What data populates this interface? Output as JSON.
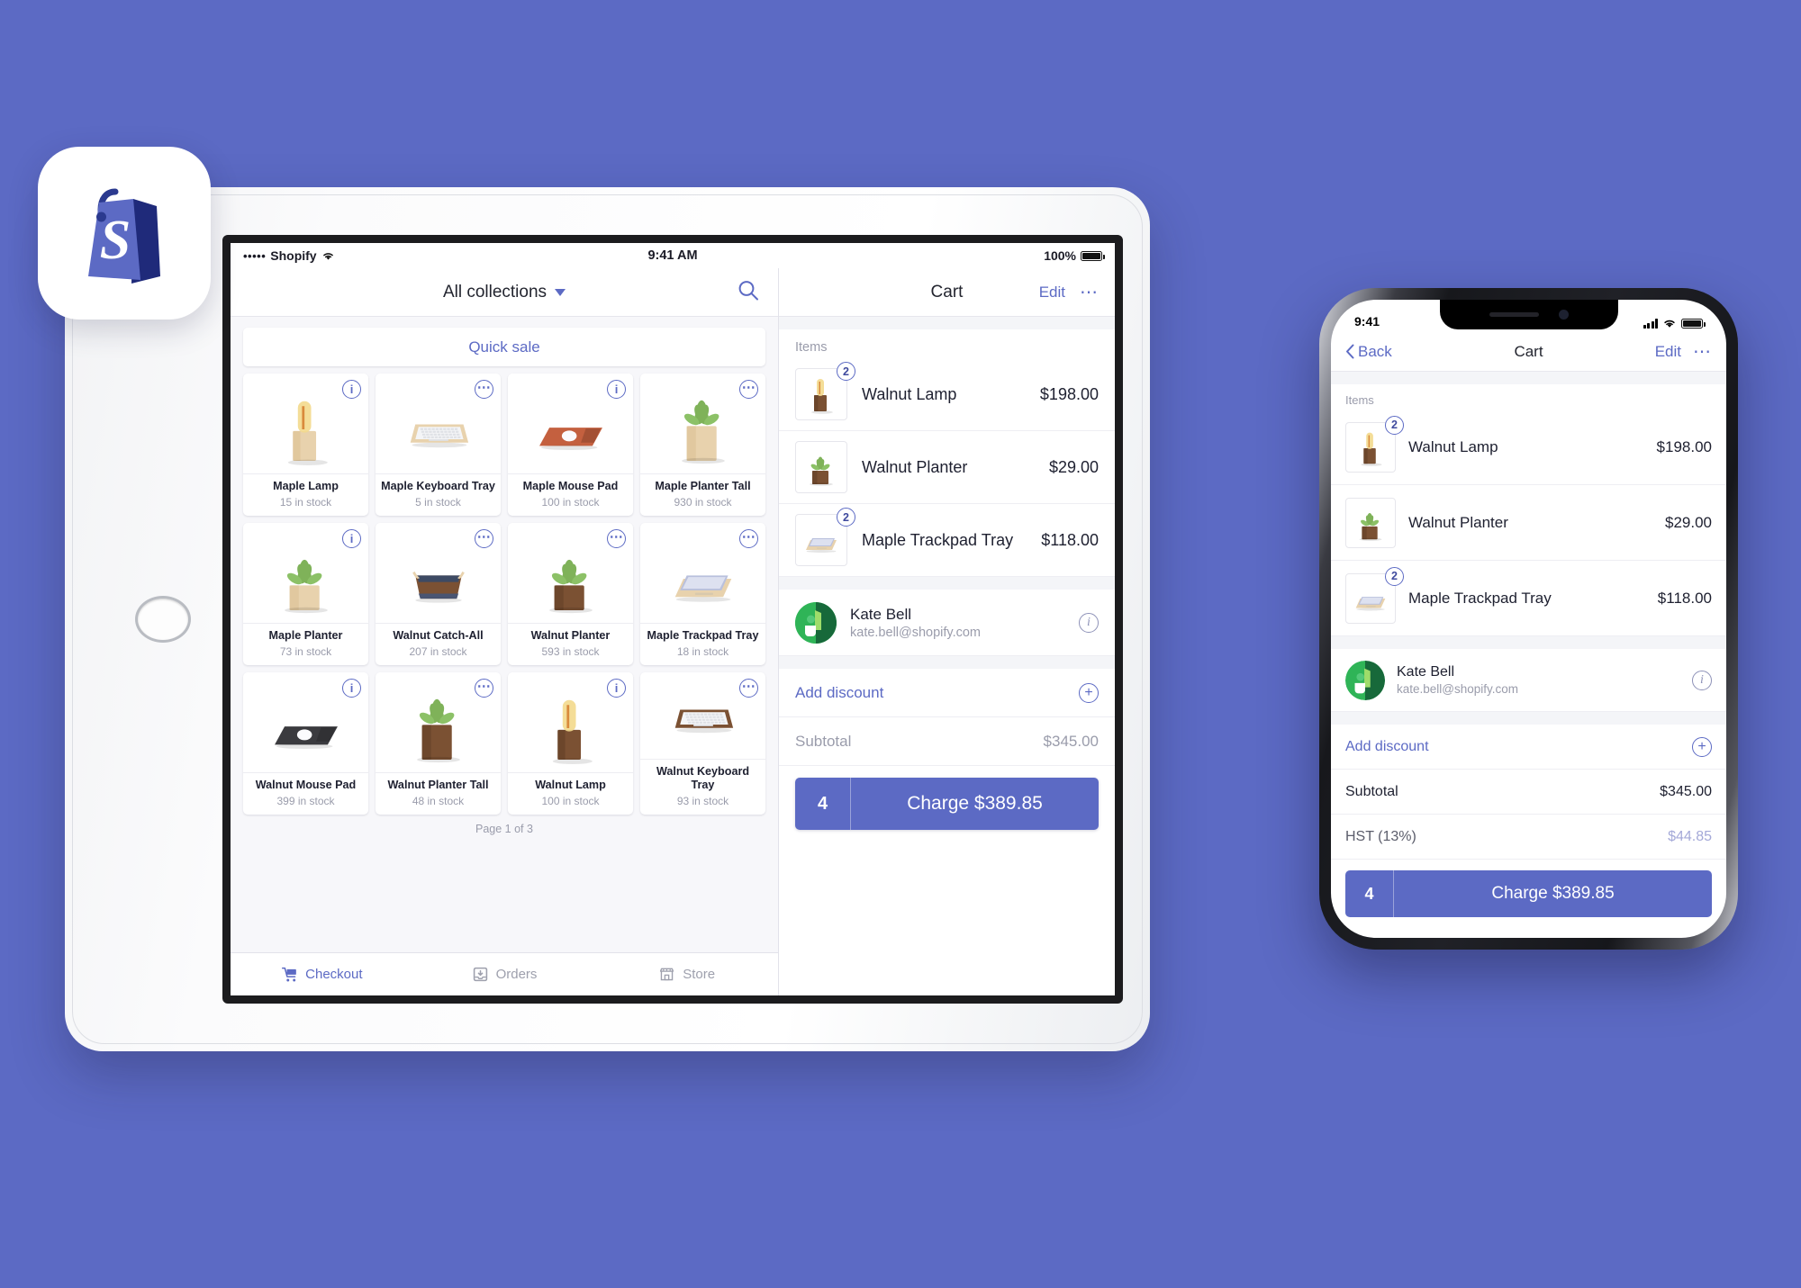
{
  "brand": {
    "accent": "#5c6ac4",
    "background": "#5c6ac4",
    "app_icon": "shopify-bag-icon"
  },
  "ipad": {
    "status_bar": {
      "carrier": "Shopify",
      "signal_dots": "•••••",
      "wifi_icon": "wifi-icon",
      "time": "9:41 AM",
      "battery_percent": "100%",
      "battery_icon": "battery-full-icon"
    },
    "catalog": {
      "collections_label": "All collections",
      "dropdown_icon": "chevron-down-icon",
      "search_icon": "search-icon",
      "quick_sale_label": "Quick sale",
      "page_indicator": "Page 1 of 3",
      "products": [
        {
          "name": "Maple Lamp",
          "stock": "15 in stock",
          "badge": "info",
          "image": "maple-lamp"
        },
        {
          "name": "Maple Keyboard Tray",
          "stock": "5 in stock",
          "badge": "more",
          "image": "maple-keyboard-tray"
        },
        {
          "name": "Maple Mouse Pad",
          "stock": "100 in stock",
          "badge": "info",
          "image": "maple-mouse-pad"
        },
        {
          "name": "Maple Planter Tall",
          "stock": "930 in stock",
          "badge": "more",
          "image": "maple-planter-tall"
        },
        {
          "name": "Maple Planter",
          "stock": "73 in stock",
          "badge": "info",
          "image": "maple-planter"
        },
        {
          "name": "Walnut Catch-All",
          "stock": "207 in stock",
          "badge": "more",
          "image": "walnut-catch-all"
        },
        {
          "name": "Walnut Planter",
          "stock": "593 in stock",
          "badge": "more",
          "image": "walnut-planter"
        },
        {
          "name": "Maple Trackpad Tray",
          "stock": "18 in stock",
          "badge": "more",
          "image": "maple-trackpad-tray"
        },
        {
          "name": "Walnut Mouse Pad",
          "stock": "399 in stock",
          "badge": "info",
          "image": "walnut-mouse-pad"
        },
        {
          "name": "Walnut Planter Tall",
          "stock": "48 in stock",
          "badge": "more",
          "image": "walnut-planter-tall"
        },
        {
          "name": "Walnut Lamp",
          "stock": "100 in stock",
          "badge": "info",
          "image": "walnut-lamp"
        },
        {
          "name": "Walnut Keyboard Tray",
          "stock": "93 in stock",
          "badge": "more",
          "image": "walnut-keyboard-tray"
        }
      ]
    },
    "tabs": [
      {
        "label": "Checkout",
        "icon": "cart-icon",
        "active": true
      },
      {
        "label": "Orders",
        "icon": "inbox-icon",
        "active": false
      },
      {
        "label": "Store",
        "icon": "store-icon",
        "active": false
      }
    ],
    "cart": {
      "title": "Cart",
      "edit_label": "Edit",
      "more_icon": "ellipsis-icon",
      "items_label": "Items",
      "items": [
        {
          "name": "Walnut Lamp",
          "price": "$198.00",
          "qty": "2",
          "image": "walnut-lamp"
        },
        {
          "name": "Walnut Planter",
          "price": "$29.00",
          "qty": "",
          "image": "walnut-planter"
        },
        {
          "name": "Maple Trackpad Tray",
          "price": "$118.00",
          "qty": "2",
          "image": "maple-trackpad-tray"
        }
      ],
      "customer": {
        "name": "Kate Bell",
        "email": "kate.bell@shopify.com",
        "info_icon": "info-circle-icon",
        "avatar": "kate-bell-avatar"
      },
      "discount_label": "Add discount",
      "discount_icon": "plus-circle-icon",
      "subtotal_label": "Subtotal",
      "subtotal_value": "$345.00",
      "charge_qty": "4",
      "charge_label": "Charge $389.85"
    }
  },
  "iphone": {
    "status_bar": {
      "time": "9:41",
      "signal_icon": "cellular-bars-icon",
      "wifi_icon": "wifi-icon",
      "battery_icon": "battery-full-icon"
    },
    "nav": {
      "back_label": "Back",
      "back_icon": "chevron-left-icon",
      "title": "Cart",
      "edit_label": "Edit",
      "more_icon": "ellipsis-icon"
    },
    "cart": {
      "items_label": "Items",
      "items": [
        {
          "name": "Walnut Lamp",
          "price": "$198.00",
          "qty": "2",
          "image": "walnut-lamp"
        },
        {
          "name": "Walnut Planter",
          "price": "$29.00",
          "qty": "",
          "image": "walnut-planter"
        },
        {
          "name": "Maple Trackpad Tray",
          "price": "$118.00",
          "qty": "2",
          "image": "maple-trackpad-tray"
        }
      ],
      "customer": {
        "name": "Kate Bell",
        "email": "kate.bell@shopify.com",
        "info_icon": "info-circle-icon",
        "avatar": "kate-bell-avatar"
      },
      "discount_label": "Add discount",
      "discount_icon": "plus-circle-icon",
      "subtotal_label": "Subtotal",
      "subtotal_value": "$345.00",
      "tax_label": "HST (13%)",
      "tax_value": "$44.85",
      "charge_qty": "4",
      "charge_label": "Charge $389.85"
    }
  }
}
